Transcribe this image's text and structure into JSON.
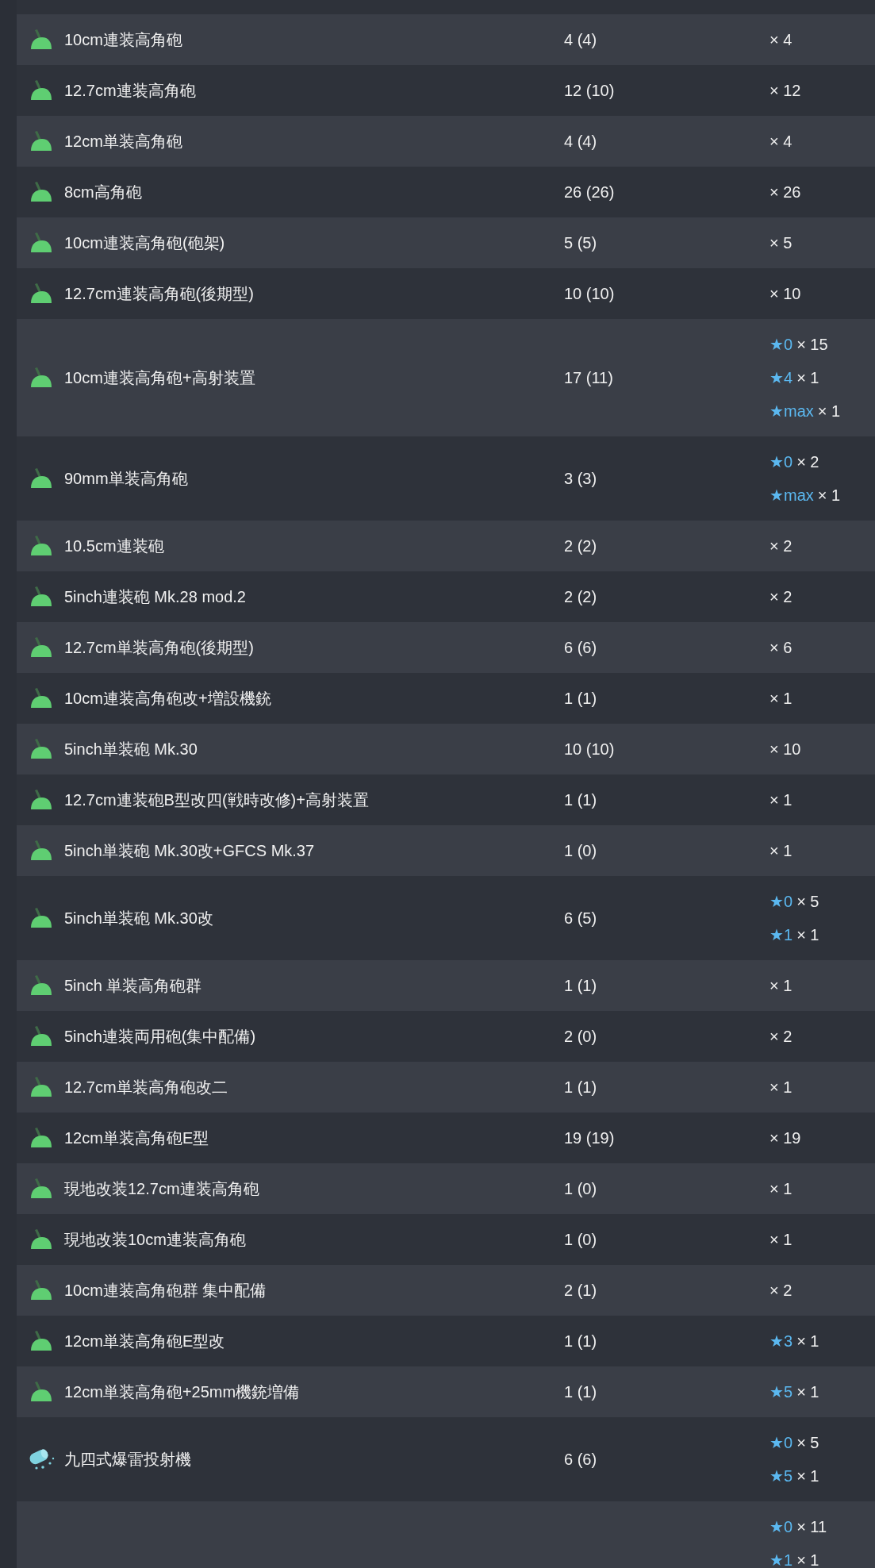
{
  "rows": [
    {
      "kind": "gun",
      "name": "10cm連装高角砲",
      "count": "4 (4)",
      "improvements": [
        {
          "count": "× 4"
        }
      ]
    },
    {
      "kind": "gun",
      "name": "12.7cm連装高角砲",
      "count": "12 (10)",
      "improvements": [
        {
          "count": "× 12"
        }
      ]
    },
    {
      "kind": "gun",
      "name": "12cm単装高角砲",
      "count": "4 (4)",
      "improvements": [
        {
          "count": "× 4"
        }
      ]
    },
    {
      "kind": "gun",
      "name": "8cm高角砲",
      "count": "26 (26)",
      "improvements": [
        {
          "count": "× 26"
        }
      ]
    },
    {
      "kind": "gun",
      "name": "10cm連装高角砲(砲架)",
      "count": "5 (5)",
      "improvements": [
        {
          "count": "× 5"
        }
      ]
    },
    {
      "kind": "gun",
      "name": "12.7cm連装高角砲(後期型)",
      "count": "10 (10)",
      "improvements": [
        {
          "count": "× 10"
        }
      ]
    },
    {
      "kind": "gun",
      "name": "10cm連装高角砲+高射装置",
      "count": "17 (11)",
      "improvements": [
        {
          "star": "★0",
          "count": "× 15"
        },
        {
          "star": "★4",
          "count": "× 1"
        },
        {
          "star": "★max",
          "count": "× 1"
        }
      ]
    },
    {
      "kind": "gun",
      "name": "90mm単装高角砲",
      "count": "3 (3)",
      "improvements": [
        {
          "star": "★0",
          "count": "× 2"
        },
        {
          "star": "★max",
          "count": "× 1"
        }
      ]
    },
    {
      "kind": "gun",
      "name": "10.5cm連装砲",
      "count": "2 (2)",
      "improvements": [
        {
          "count": "× 2"
        }
      ]
    },
    {
      "kind": "gun",
      "name": "5inch連装砲 Mk.28 mod.2",
      "count": "2 (2)",
      "improvements": [
        {
          "count": "× 2"
        }
      ]
    },
    {
      "kind": "gun",
      "name": "12.7cm単装高角砲(後期型)",
      "count": "6 (6)",
      "improvements": [
        {
          "count": "× 6"
        }
      ]
    },
    {
      "kind": "gun",
      "name": "10cm連装高角砲改+増設機銃",
      "count": "1 (1)",
      "improvements": [
        {
          "count": "× 1"
        }
      ]
    },
    {
      "kind": "gun",
      "name": "5inch単装砲 Mk.30",
      "count": "10 (10)",
      "improvements": [
        {
          "count": "× 10"
        }
      ]
    },
    {
      "kind": "gun",
      "name": "12.7cm連装砲B型改四(戦時改修)+高射装置",
      "count": "1 (1)",
      "improvements": [
        {
          "count": "× 1"
        }
      ]
    },
    {
      "kind": "gun",
      "name": "5inch単装砲 Mk.30改+GFCS Mk.37",
      "count": "1 (0)",
      "improvements": [
        {
          "count": "× 1"
        }
      ]
    },
    {
      "kind": "gun",
      "name": "5inch単装砲 Mk.30改",
      "count": "6 (5)",
      "improvements": [
        {
          "star": "★0",
          "count": "× 5"
        },
        {
          "star": "★1",
          "count": "× 1"
        }
      ]
    },
    {
      "kind": "gun",
      "name": "5inch 単装高角砲群",
      "count": "1 (1)",
      "improvements": [
        {
          "count": "× 1"
        }
      ]
    },
    {
      "kind": "gun",
      "name": "5inch連装両用砲(集中配備)",
      "count": "2 (0)",
      "improvements": [
        {
          "count": "× 2"
        }
      ]
    },
    {
      "kind": "gun",
      "name": "12.7cm単装高角砲改二",
      "count": "1 (1)",
      "improvements": [
        {
          "count": "× 1"
        }
      ]
    },
    {
      "kind": "gun",
      "name": "12cm単装高角砲E型",
      "count": "19 (19)",
      "improvements": [
        {
          "count": "× 19"
        }
      ]
    },
    {
      "kind": "gun",
      "name": "現地改装12.7cm連装高角砲",
      "count": "1 (0)",
      "improvements": [
        {
          "count": "× 1"
        }
      ]
    },
    {
      "kind": "gun",
      "name": "現地改装10cm連装高角砲",
      "count": "1 (0)",
      "improvements": [
        {
          "count": "× 1"
        }
      ]
    },
    {
      "kind": "gun",
      "name": "10cm連装高角砲群 集中配備",
      "count": "2 (1)",
      "improvements": [
        {
          "count": "× 2"
        }
      ]
    },
    {
      "kind": "gun",
      "name": "12cm単装高角砲E型改",
      "count": "1 (1)",
      "improvements": [
        {
          "star": "★3",
          "count": "× 1"
        }
      ]
    },
    {
      "kind": "gun",
      "name": "12cm単装高角砲+25mm機銃増備",
      "count": "1 (1)",
      "improvements": [
        {
          "star": "★5",
          "count": "× 1"
        }
      ]
    },
    {
      "kind": "depth_charge",
      "name": "九四式爆雷投射機",
      "count": "6 (6)",
      "improvements": [
        {
          "star": "★0",
          "count": "× 5"
        },
        {
          "star": "★5",
          "count": "× 1"
        }
      ]
    },
    {
      "kind": "partial",
      "improvements": [
        {
          "star": "★0",
          "count": "× 11"
        },
        {
          "star": "★1",
          "count": "× 1"
        }
      ]
    }
  ]
}
